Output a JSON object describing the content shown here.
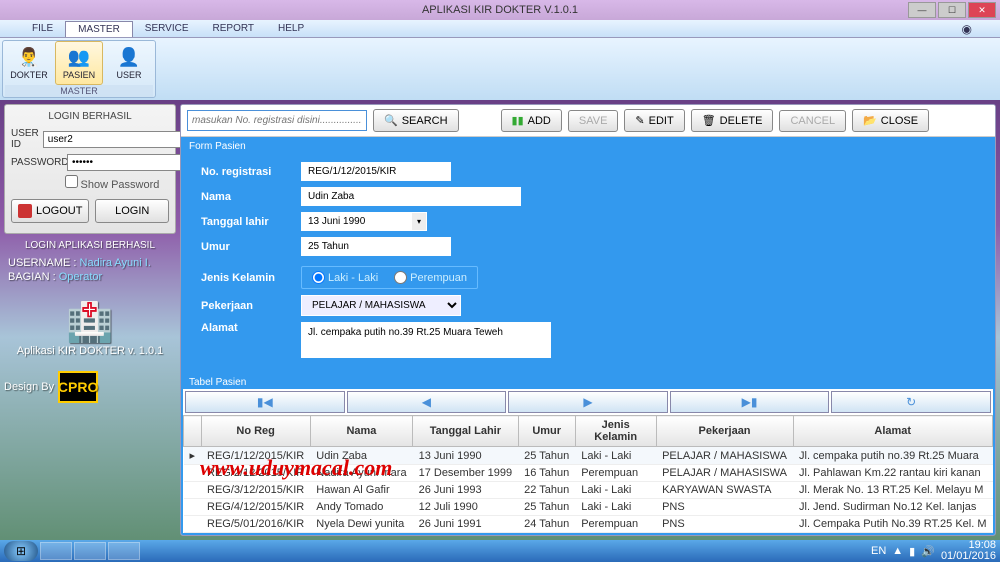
{
  "title": "APLIKASI KIR DOKTER V.1.0.1",
  "menu": {
    "file": "FILE",
    "master": "MASTER",
    "service": "SERVICE",
    "report": "REPORT",
    "help": "HELP"
  },
  "ribbon": {
    "group_label": "MASTER",
    "dokter": "DOKTER",
    "pasien": "PASIEN",
    "user": "USER"
  },
  "login_box": {
    "title": "LOGIN BERHASIL",
    "user_label": "USER ID",
    "user_value": "user2",
    "pass_label": "PASSWORD",
    "pass_value": "••••••",
    "show_pw": "Show Password",
    "logout": "LOGOUT",
    "login": "LOGIN"
  },
  "login_info": {
    "title": "LOGIN APLIKASI BERHASIL",
    "user_lbl": "USERNAME :",
    "user_val": "Nadira Ayuni I.",
    "bag_lbl": "BAGIAN     :",
    "bag_val": "Operator"
  },
  "app_footer": "Aplikasi KIR DOKTER v. 1.0.1",
  "design_by": "Design By",
  "design_logo": "CPRO",
  "toolbar": {
    "search_ph": "masukan No. registrasi disini................",
    "search": "SEARCH",
    "add": "ADD",
    "save": "SAVE",
    "edit": "EDIT",
    "delete": "DELETE",
    "cancel": "CANCEL",
    "close": "CLOSE"
  },
  "form": {
    "title": "Form Pasien",
    "noreg_lbl": "No. registrasi",
    "noreg_val": "REG/1/12/2015/KIR",
    "nama_lbl": "Nama",
    "nama_val": "Udin Zaba",
    "tgl_lbl": "Tanggal lahir",
    "tgl_val": "13 Juni 1990",
    "umur_lbl": "Umur",
    "umur_val": "25 Tahun",
    "jk_lbl": "Jenis Kelamin",
    "jk_laki": "Laki - Laki",
    "jk_per": "Perempuan",
    "pek_lbl": "Pekerjaan",
    "pek_val": "PELAJAR / MAHASISWA",
    "alamat_lbl": "Alamat",
    "alamat_val": "Jl. cempaka putih no.39 Rt.25 Muara Teweh"
  },
  "table": {
    "title": "Tabel Pasien",
    "cols": {
      "noreg": "No Reg",
      "nama": "Nama",
      "tgl": "Tanggal Lahir",
      "umur": "Umur",
      "jk": "Jenis Kelamin",
      "pek": "Pekerjaan",
      "alamat": "Alamat"
    },
    "rows": [
      {
        "noreg": "REG/1/12/2015/KIR",
        "nama": "Udin Zaba",
        "tgl": "13 Juni 1990",
        "umur": "25 Tahun",
        "jk": "Laki - Laki",
        "pek": "PELAJAR / MAHASISWA",
        "alamat": "Jl. cempaka putih no.39 Rt.25 Muara"
      },
      {
        "noreg": "REG/2/12/2015/KIR",
        "nama": "Nadira Ayuni Inara",
        "tgl": "17 Desember 1999",
        "umur": "16 Tahun",
        "jk": "Perempuan",
        "pek": "PELAJAR / MAHASISWA",
        "alamat": "Jl. Pahlawan Km.22 rantau kiri kanan"
      },
      {
        "noreg": "REG/3/12/2015/KIR",
        "nama": "Hawan Al Gafir",
        "tgl": "26 Juni 1993",
        "umur": "22 Tahun",
        "jk": "Laki - Laki",
        "pek": "KARYAWAN SWASTA",
        "alamat": "Jl. Merak No. 13 RT.25 Kel. Melayu M"
      },
      {
        "noreg": "REG/4/12/2015/KIR",
        "nama": "Andy Tomado",
        "tgl": "12 Juli 1990",
        "umur": "25 Tahun",
        "jk": "Laki - Laki",
        "pek": "PNS",
        "alamat": "Jl. Jend. Sudirman No.12 Kel. lanjas"
      },
      {
        "noreg": "REG/5/01/2016/KIR",
        "nama": "Nyela Dewi yunita",
        "tgl": "26 Juni 1991",
        "umur": "24 Tahun",
        "jk": "Perempuan",
        "pek": "PNS",
        "alamat": "Jl. Cempaka Putih No.39 RT.25 Kel. M"
      }
    ]
  },
  "taskbar": {
    "lang": "EN",
    "time": "19:08",
    "date": "01/01/2016"
  },
  "watermark": "www.uduymacal.com"
}
